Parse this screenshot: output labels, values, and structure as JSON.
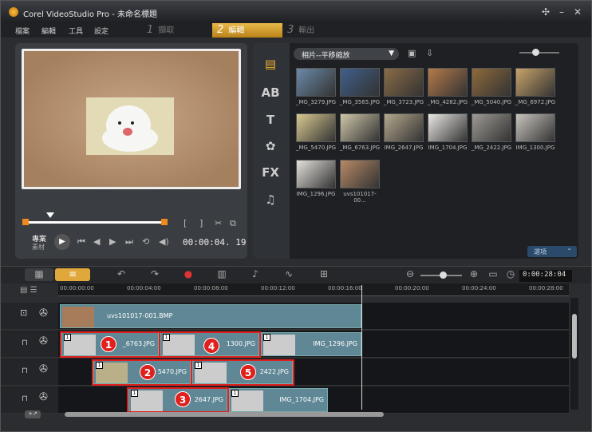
{
  "title": "Corel VideoStudio Pro - 未命名標題",
  "menus": [
    "檔案",
    "編輯",
    "工具",
    "設定"
  ],
  "steps": [
    {
      "num": "1",
      "label": "擷取"
    },
    {
      "num": "2",
      "label": "編輯"
    },
    {
      "num": "3",
      "label": "輸出"
    }
  ],
  "player": {
    "project_label": "專案",
    "clip_label": "素材",
    "timecode": "00:00:04. 19"
  },
  "library": {
    "dropdown": "相片--平移縮放",
    "options_label": "選項",
    "thumbs": [
      "_MG_3279.JPG",
      "_MG_3565.JPG",
      "_MG_3723.JPG",
      "_MG_4282.JPG",
      "_MG_5040.JPG",
      "_MG_6972.JPG",
      "_MG_5470.JPG",
      "_MG_6763.JPG",
      "IMG_2647.JPG",
      "IMG_1704.JPG",
      "_MG_2422.JPG",
      "IMG_1300.JPG",
      "IMG_1296.JPG",
      "uvs101017-00..."
    ]
  },
  "timeline": {
    "timecode": "0:00:28:04",
    "ruler": [
      "00:00:00:00",
      "00:00:04:00",
      "00:00:08:00",
      "00:00:12:00",
      "00:00:16:00",
      "00:00:20:00",
      "00:00:24:00",
      "00:00:28:00"
    ],
    "bg_clip": "uvs101017-001.BMP",
    "clips": [
      "_6763.JPG",
      "1300.JPG",
      "IMG_1296.JPG",
      "5470.JPG",
      "2422.JPG",
      "2647.JPG",
      "IMG_1704.JPG"
    ],
    "badges": [
      "1",
      "2",
      "3",
      "4",
      "5"
    ]
  }
}
